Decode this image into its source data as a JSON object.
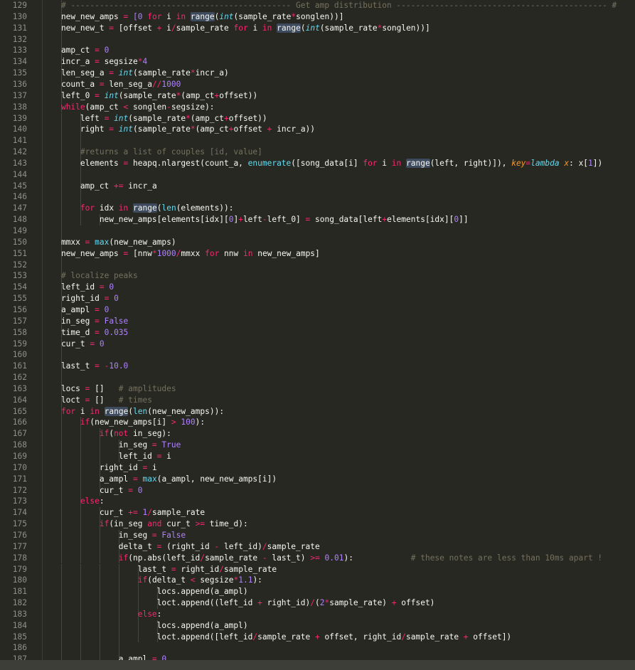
{
  "editor": {
    "first_line_number": 129,
    "lines": [
      [
        {
          "t": "    "
        },
        {
          "t": "# ---------------------------------------------- Get amp distribution -------------------------------------------- #",
          "s": "c"
        }
      ],
      [
        {
          "t": "    new_new_amps "
        },
        {
          "t": "=",
          "s": "k"
        },
        {
          "t": " [0 ",
          "s": "n"
        },
        {
          "t": "for",
          "s": "k"
        },
        {
          "t": " i "
        },
        {
          "t": "in",
          "s": "k"
        },
        {
          "t": " "
        },
        {
          "t": "range",
          "s": "sel"
        },
        {
          "t": "("
        },
        {
          "t": "int",
          "s": "bi"
        },
        {
          "t": "(sample_rate"
        },
        {
          "t": "*",
          "s": "k"
        },
        {
          "t": "songlen))]"
        }
      ],
      [
        {
          "t": "    new_new_t "
        },
        {
          "t": "=",
          "s": "k"
        },
        {
          "t": " [offset "
        },
        {
          "t": "+",
          "s": "k"
        },
        {
          "t": " i"
        },
        {
          "t": "/",
          "s": "k"
        },
        {
          "t": "sample_rate "
        },
        {
          "t": "for",
          "s": "k"
        },
        {
          "t": " i "
        },
        {
          "t": "in",
          "s": "k"
        },
        {
          "t": " "
        },
        {
          "t": "range",
          "s": "sel"
        },
        {
          "t": "("
        },
        {
          "t": "int",
          "s": "bi"
        },
        {
          "t": "(sample_rate"
        },
        {
          "t": "*",
          "s": "k"
        },
        {
          "t": "songlen))]"
        }
      ],
      [],
      [
        {
          "t": "    amp_ct "
        },
        {
          "t": "=",
          "s": "k"
        },
        {
          "t": " "
        },
        {
          "t": "0",
          "s": "n"
        }
      ],
      [
        {
          "t": "    incr_a "
        },
        {
          "t": "=",
          "s": "k"
        },
        {
          "t": " segsize"
        },
        {
          "t": "*",
          "s": "k"
        },
        {
          "t": "4",
          "s": "n"
        }
      ],
      [
        {
          "t": "    len_seg_a "
        },
        {
          "t": "=",
          "s": "k"
        },
        {
          "t": " "
        },
        {
          "t": "int",
          "s": "bi"
        },
        {
          "t": "(sample_rate"
        },
        {
          "t": "*",
          "s": "k"
        },
        {
          "t": "incr_a)"
        }
      ],
      [
        {
          "t": "    count_a "
        },
        {
          "t": "=",
          "s": "k"
        },
        {
          "t": " len_seg_a"
        },
        {
          "t": "//",
          "s": "k"
        },
        {
          "t": "1000",
          "s": "n"
        }
      ],
      [
        {
          "t": "    left_0 "
        },
        {
          "t": "=",
          "s": "k"
        },
        {
          "t": " "
        },
        {
          "t": "int",
          "s": "bi"
        },
        {
          "t": "(sample_rate"
        },
        {
          "t": "*",
          "s": "k"
        },
        {
          "t": "(amp_ct"
        },
        {
          "t": "+",
          "s": "k"
        },
        {
          "t": "offset))"
        }
      ],
      [
        {
          "t": "    "
        },
        {
          "t": "while",
          "s": "k"
        },
        {
          "t": "(amp_ct "
        },
        {
          "t": "<",
          "s": "k"
        },
        {
          "t": " songlen"
        },
        {
          "t": "-",
          "s": "k"
        },
        {
          "t": "segsize):"
        }
      ],
      [
        {
          "t": "        left "
        },
        {
          "t": "=",
          "s": "k"
        },
        {
          "t": " "
        },
        {
          "t": "int",
          "s": "bi"
        },
        {
          "t": "(sample_rate"
        },
        {
          "t": "*",
          "s": "k"
        },
        {
          "t": "(amp_ct"
        },
        {
          "t": "+",
          "s": "k"
        },
        {
          "t": "offset))"
        }
      ],
      [
        {
          "t": "        right "
        },
        {
          "t": "=",
          "s": "k"
        },
        {
          "t": " "
        },
        {
          "t": "int",
          "s": "bi"
        },
        {
          "t": "(sample_rate"
        },
        {
          "t": "*",
          "s": "k"
        },
        {
          "t": "(amp_ct"
        },
        {
          "t": "+",
          "s": "k"
        },
        {
          "t": "offset "
        },
        {
          "t": "+",
          "s": "k"
        },
        {
          "t": " incr_a))"
        }
      ],
      [],
      [
        {
          "t": "        "
        },
        {
          "t": "#returns a list of couples [id, value]",
          "s": "c"
        }
      ],
      [
        {
          "t": "        elements "
        },
        {
          "t": "=",
          "s": "k"
        },
        {
          "t": " heapq.nlargest(count_a, "
        },
        {
          "t": "enumerate",
          "s": "b"
        },
        {
          "t": "([song_data[i] "
        },
        {
          "t": "for",
          "s": "k"
        },
        {
          "t": " i "
        },
        {
          "t": "in",
          "s": "k"
        },
        {
          "t": " "
        },
        {
          "t": "range",
          "s": "sel"
        },
        {
          "t": "(left, right)]), "
        },
        {
          "t": "key",
          "s": "p"
        },
        {
          "t": "=",
          "s": "k"
        },
        {
          "t": "lambda",
          "s": "bi"
        },
        {
          "t": " "
        },
        {
          "t": "x",
          "s": "p"
        },
        {
          "t": ": x["
        },
        {
          "t": "1",
          "s": "n"
        },
        {
          "t": "])"
        }
      ],
      [],
      [
        {
          "t": "        amp_ct "
        },
        {
          "t": "+=",
          "s": "k"
        },
        {
          "t": " incr_a"
        }
      ],
      [],
      [
        {
          "t": "        "
        },
        {
          "t": "for",
          "s": "k"
        },
        {
          "t": " idx "
        },
        {
          "t": "in",
          "s": "k"
        },
        {
          "t": " "
        },
        {
          "t": "range",
          "s": "sel"
        },
        {
          "t": "("
        },
        {
          "t": "len",
          "s": "b"
        },
        {
          "t": "(elements)):"
        }
      ],
      [
        {
          "t": "            new_new_amps[elements[idx]["
        },
        {
          "t": "0",
          "s": "n"
        },
        {
          "t": "]"
        },
        {
          "t": "+",
          "s": "k"
        },
        {
          "t": "left"
        },
        {
          "t": "-",
          "s": "k"
        },
        {
          "t": "left_0] "
        },
        {
          "t": "=",
          "s": "k"
        },
        {
          "t": " song_data[left"
        },
        {
          "t": "+",
          "s": "k"
        },
        {
          "t": "elements[idx]["
        },
        {
          "t": "0",
          "s": "n"
        },
        {
          "t": "]]"
        }
      ],
      [],
      [
        {
          "t": "    mmxx "
        },
        {
          "t": "=",
          "s": "k"
        },
        {
          "t": " "
        },
        {
          "t": "max",
          "s": "b"
        },
        {
          "t": "(new_new_amps)"
        }
      ],
      [
        {
          "t": "    new_new_amps "
        },
        {
          "t": "=",
          "s": "k"
        },
        {
          "t": " [nnw"
        },
        {
          "t": "*",
          "s": "k"
        },
        {
          "t": "1000",
          "s": "n"
        },
        {
          "t": "/",
          "s": "k"
        },
        {
          "t": "mmxx "
        },
        {
          "t": "for",
          "s": "k"
        },
        {
          "t": " nnw "
        },
        {
          "t": "in",
          "s": "k"
        },
        {
          "t": " new_new_amps]"
        }
      ],
      [],
      [
        {
          "t": "    "
        },
        {
          "t": "# localize peaks",
          "s": "c"
        }
      ],
      [
        {
          "t": "    left_id "
        },
        {
          "t": "=",
          "s": "k"
        },
        {
          "t": " "
        },
        {
          "t": "0",
          "s": "n"
        }
      ],
      [
        {
          "t": "    right_id "
        },
        {
          "t": "=",
          "s": "k"
        },
        {
          "t": " "
        },
        {
          "t": "0",
          "s": "n"
        }
      ],
      [
        {
          "t": "    a_ampl "
        },
        {
          "t": "=",
          "s": "k"
        },
        {
          "t": " "
        },
        {
          "t": "0",
          "s": "n"
        }
      ],
      [
        {
          "t": "    in_seg "
        },
        {
          "t": "=",
          "s": "k"
        },
        {
          "t": " "
        },
        {
          "t": "False",
          "s": "n"
        }
      ],
      [
        {
          "t": "    time_d "
        },
        {
          "t": "=",
          "s": "k"
        },
        {
          "t": " "
        },
        {
          "t": "0.035",
          "s": "n"
        }
      ],
      [
        {
          "t": "    cur_t "
        },
        {
          "t": "=",
          "s": "k"
        },
        {
          "t": " "
        },
        {
          "t": "0",
          "s": "n"
        }
      ],
      [],
      [
        {
          "t": "    last_t "
        },
        {
          "t": "=",
          "s": "k"
        },
        {
          "t": " "
        },
        {
          "t": "-",
          "s": "k"
        },
        {
          "t": "10.0",
          "s": "n"
        }
      ],
      [],
      [
        {
          "t": "    locs "
        },
        {
          "t": "=",
          "s": "k"
        },
        {
          "t": " []   "
        },
        {
          "t": "# amplitudes",
          "s": "c"
        }
      ],
      [
        {
          "t": "    loct "
        },
        {
          "t": "=",
          "s": "k"
        },
        {
          "t": " []   "
        },
        {
          "t": "# times",
          "s": "c"
        }
      ],
      [
        {
          "t": "    "
        },
        {
          "t": "for",
          "s": "k"
        },
        {
          "t": " i "
        },
        {
          "t": "in",
          "s": "k"
        },
        {
          "t": " "
        },
        {
          "t": "range",
          "s": "sel"
        },
        {
          "t": "("
        },
        {
          "t": "len",
          "s": "b"
        },
        {
          "t": "(new_new_amps)):"
        }
      ],
      [
        {
          "t": "        "
        },
        {
          "t": "if",
          "s": "k"
        },
        {
          "t": "(new_new_amps[i] "
        },
        {
          "t": ">",
          "s": "k"
        },
        {
          "t": " "
        },
        {
          "t": "100",
          "s": "n"
        },
        {
          "t": "):"
        }
      ],
      [
        {
          "t": "            "
        },
        {
          "t": "if",
          "s": "k"
        },
        {
          "t": "("
        },
        {
          "t": "not",
          "s": "k"
        },
        {
          "t": " in_seg):"
        }
      ],
      [
        {
          "t": "                in_seg "
        },
        {
          "t": "=",
          "s": "k"
        },
        {
          "t": " "
        },
        {
          "t": "True",
          "s": "n"
        }
      ],
      [
        {
          "t": "                left_id "
        },
        {
          "t": "=",
          "s": "k"
        },
        {
          "t": " i"
        }
      ],
      [
        {
          "t": "            right_id "
        },
        {
          "t": "=",
          "s": "k"
        },
        {
          "t": " i"
        }
      ],
      [
        {
          "t": "            a_ampl "
        },
        {
          "t": "=",
          "s": "k"
        },
        {
          "t": " "
        },
        {
          "t": "max",
          "s": "b"
        },
        {
          "t": "(a_ampl, new_new_amps[i])"
        }
      ],
      [
        {
          "t": "            cur_t "
        },
        {
          "t": "=",
          "s": "k"
        },
        {
          "t": " "
        },
        {
          "t": "0",
          "s": "n"
        }
      ],
      [
        {
          "t": "        "
        },
        {
          "t": "else",
          "s": "k"
        },
        {
          "t": ":"
        }
      ],
      [
        {
          "t": "            cur_t "
        },
        {
          "t": "+=",
          "s": "k"
        },
        {
          "t": " "
        },
        {
          "t": "1",
          "s": "n"
        },
        {
          "t": "/",
          "s": "k"
        },
        {
          "t": "sample_rate"
        }
      ],
      [
        {
          "t": "            "
        },
        {
          "t": "if",
          "s": "k"
        },
        {
          "t": "(in_seg "
        },
        {
          "t": "and",
          "s": "k"
        },
        {
          "t": " cur_t "
        },
        {
          "t": ">=",
          "s": "k"
        },
        {
          "t": " time_d):"
        }
      ],
      [
        {
          "t": "                in_seg "
        },
        {
          "t": "=",
          "s": "k"
        },
        {
          "t": " "
        },
        {
          "t": "False",
          "s": "n"
        }
      ],
      [
        {
          "t": "                delta_t "
        },
        {
          "t": "=",
          "s": "k"
        },
        {
          "t": " (right_id "
        },
        {
          "t": "-",
          "s": "k"
        },
        {
          "t": " left_id)"
        },
        {
          "t": "/",
          "s": "k"
        },
        {
          "t": "sample_rate"
        }
      ],
      [
        {
          "t": "                "
        },
        {
          "t": "if",
          "s": "k"
        },
        {
          "t": "(np.abs(left_id"
        },
        {
          "t": "/",
          "s": "k"
        },
        {
          "t": "sample_rate "
        },
        {
          "t": "-",
          "s": "k"
        },
        {
          "t": " last_t) "
        },
        {
          "t": ">=",
          "s": "k"
        },
        {
          "t": " "
        },
        {
          "t": "0.01",
          "s": "n"
        },
        {
          "t": "):            "
        },
        {
          "t": "# these notes are less than 10ms apart !",
          "s": "c"
        }
      ],
      [
        {
          "t": "                    last_t "
        },
        {
          "t": "=",
          "s": "k"
        },
        {
          "t": " right_id"
        },
        {
          "t": "/",
          "s": "k"
        },
        {
          "t": "sample_rate"
        }
      ],
      [
        {
          "t": "                    "
        },
        {
          "t": "if",
          "s": "k"
        },
        {
          "t": "(delta_t "
        },
        {
          "t": "<",
          "s": "k"
        },
        {
          "t": " segsize"
        },
        {
          "t": "*",
          "s": "k"
        },
        {
          "t": "1.1",
          "s": "n"
        },
        {
          "t": "):"
        }
      ],
      [
        {
          "t": "                        locs.append(a_ampl)"
        }
      ],
      [
        {
          "t": "                        loct.append((left_id "
        },
        {
          "t": "+",
          "s": "k"
        },
        {
          "t": " right_id)"
        },
        {
          "t": "/",
          "s": "k"
        },
        {
          "t": "("
        },
        {
          "t": "2",
          "s": "n"
        },
        {
          "t": "*",
          "s": "k"
        },
        {
          "t": "sample_rate) "
        },
        {
          "t": "+",
          "s": "k"
        },
        {
          "t": " offset)"
        }
      ],
      [
        {
          "t": "                    "
        },
        {
          "t": "else",
          "s": "k"
        },
        {
          "t": ":"
        }
      ],
      [
        {
          "t": "                        locs.append(a_ampl)"
        }
      ],
      [
        {
          "t": "                        loct.append([left_id"
        },
        {
          "t": "/",
          "s": "k"
        },
        {
          "t": "sample_rate "
        },
        {
          "t": "+",
          "s": "k"
        },
        {
          "t": " offset, right_id"
        },
        {
          "t": "/",
          "s": "k"
        },
        {
          "t": "sample_rate "
        },
        {
          "t": "+",
          "s": "k"
        },
        {
          "t": " offset])"
        }
      ],
      [],
      [
        {
          "t": "                a_ampl "
        },
        {
          "t": "=",
          "s": "k"
        },
        {
          "t": " "
        },
        {
          "t": "0",
          "s": "n"
        }
      ]
    ]
  },
  "theme": {
    "background": "#272822",
    "foreground": "#f8f8f2",
    "keyword": "#f92672",
    "number": "#ae81ff",
    "builtin": "#66d9ef",
    "comment": "#75715e",
    "param": "#fd971f",
    "line_number": "#8f908a"
  }
}
